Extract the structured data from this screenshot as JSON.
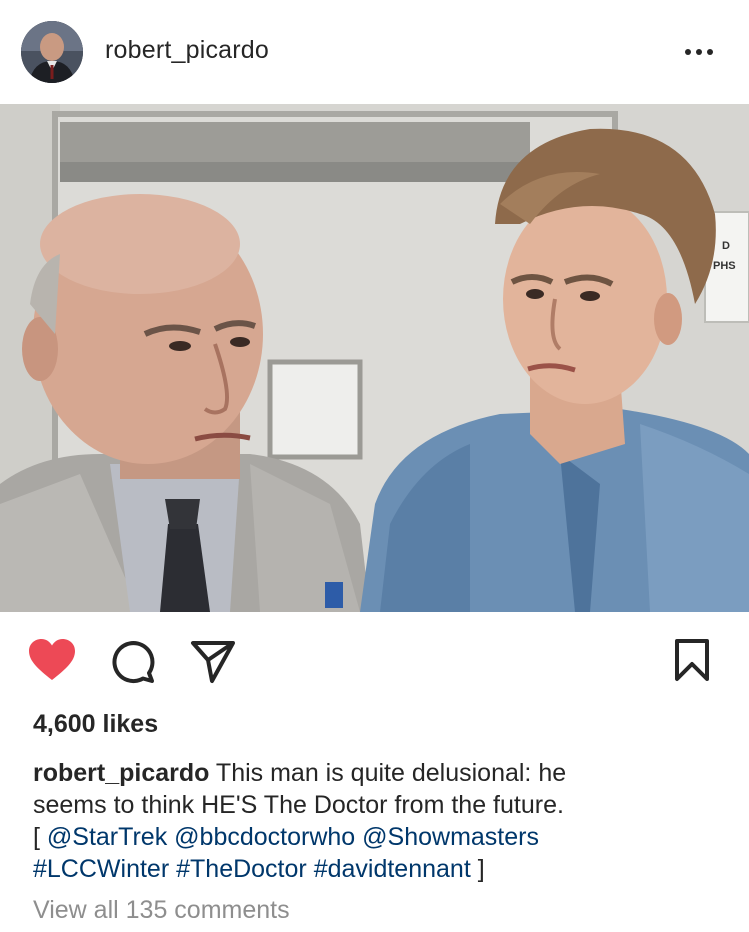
{
  "post": {
    "username": "robert_picardo",
    "likes": "4,600 likes",
    "caption": {
      "author": "robert_picardo",
      "text_line1": " This man is quite delusional: he",
      "text_line2": "seems to think HE'S The Doctor from the future.",
      "open_bracket": "[ ",
      "mentions": [
        "@StarTrek",
        "@bbcdoctorwho",
        "@Showmasters"
      ],
      "hashtags": [
        "#LCCWinter",
        "#TheDoctor",
        "#davidtennant"
      ],
      "close_bracket": " ]"
    },
    "view_comments": "View all 135 comments",
    "photo_sign_text": [
      "D",
      "PHS"
    ]
  },
  "icons": {
    "like": "heart-filled-icon",
    "comment": "comment-icon",
    "share": "paper-plane-icon",
    "save": "bookmark-icon",
    "more": "more-horizontal-icon"
  },
  "colors": {
    "heart": "#ed4956",
    "link": "#00376b",
    "muted": "#8e8e8e",
    "text": "#262626"
  }
}
